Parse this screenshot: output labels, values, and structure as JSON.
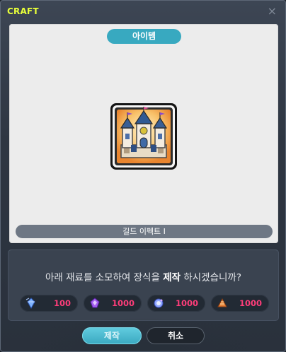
{
  "window": {
    "title": "CRAFT",
    "close_glyph": "×"
  },
  "item_panel": {
    "header_label": "아이템",
    "item_icon": "castle-trophy-icon",
    "item_name": "길드 이펙트 I"
  },
  "confirm": {
    "prefix": "아래 재료를 소모하여 장식을 ",
    "emphasis": "제작",
    "suffix": " 하시겠습니까?"
  },
  "materials": [
    {
      "icon": "blue-crystal-icon",
      "count": "100"
    },
    {
      "icon": "purple-gem-icon",
      "count": "1000"
    },
    {
      "icon": "blue-gem-icon",
      "count": "1000"
    },
    {
      "icon": "orange-cone-icon",
      "count": "1000"
    }
  ],
  "buttons": {
    "craft_label": "제작",
    "cancel_label": "취소"
  },
  "colors": {
    "title": "#e8ff3a",
    "accent": "#38a9c0",
    "count": "#ff3d7a"
  }
}
